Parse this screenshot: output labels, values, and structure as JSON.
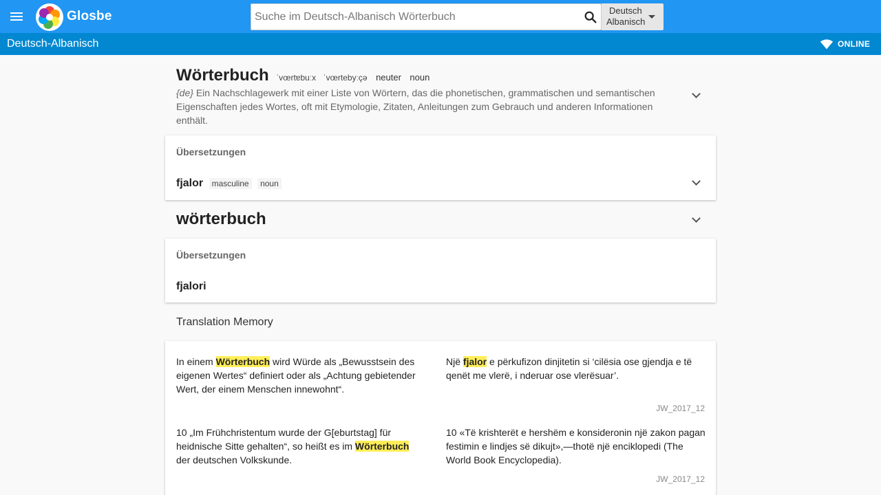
{
  "app": {
    "brand": "Glosbe",
    "search_placeholder": "Suche im Deutsch-Albanisch Wörterbuch",
    "lang_from": "Deutsch",
    "lang_to": "Albanisch",
    "pair_title": "Deutsch-Albanisch",
    "status": "ONLINE"
  },
  "entry1": {
    "headword": "Wörterbuch",
    "pron1": "ˈvœrtɐbuːx",
    "pron2": "ˈvœrtebyːçə",
    "gender": "neuter",
    "pos": "noun",
    "lang_code": "{de}",
    "definition": "Ein Nachschlagewerk mit einer Liste von Wörtern, das die phonetischen, grammatischen und semantischen Eigenschaften jedes Wortes, oft mit Etymologie, Zitaten, Anleitungen zum Gebrauch und anderen Informationen enthält.",
    "card_title": "Übersetzungen",
    "translation": "fjalor",
    "tr_gender": "masculine",
    "tr_pos": "noun"
  },
  "entry2": {
    "headword": "wörterbuch",
    "card_title": "Übersetzungen",
    "translation": "fjalori"
  },
  "memory": {
    "title": "Translation Memory",
    "pairs": [
      {
        "src_pre": "In einem ",
        "src_hl": "Wörterbuch",
        "src_post": " wird Würde als „Bewusstsein des eigenen Wertes“ definiert oder als „Achtung gebietender Wert, der einem Menschen innewohnt“.",
        "tgt_pre": "Një ",
        "tgt_hl": "fjalor",
        "tgt_post": " e përkufizon dinjitetin si ‘cilësia ose gjendja e të qenët me vlerë, i nderuar ose vlerësuar’.",
        "source": "JW_2017_12"
      },
      {
        "src_pre": "10 „Im Frühchristentum wurde der G[eburtstag] für heidnische Sitte gehalten“, so heißt es im ",
        "src_hl": "Wörterbuch",
        "src_post": " der deutschen Volkskunde.",
        "tgt_pre": "10 «Të krishterët e hershëm e konsideronin një zakon pagan festimin e lindjes së dikujt»,—thotë një enciklopedi (The World Book Encyclopedia).",
        "tgt_hl": "",
        "tgt_post": "",
        "source": "JW_2017_12"
      }
    ]
  }
}
